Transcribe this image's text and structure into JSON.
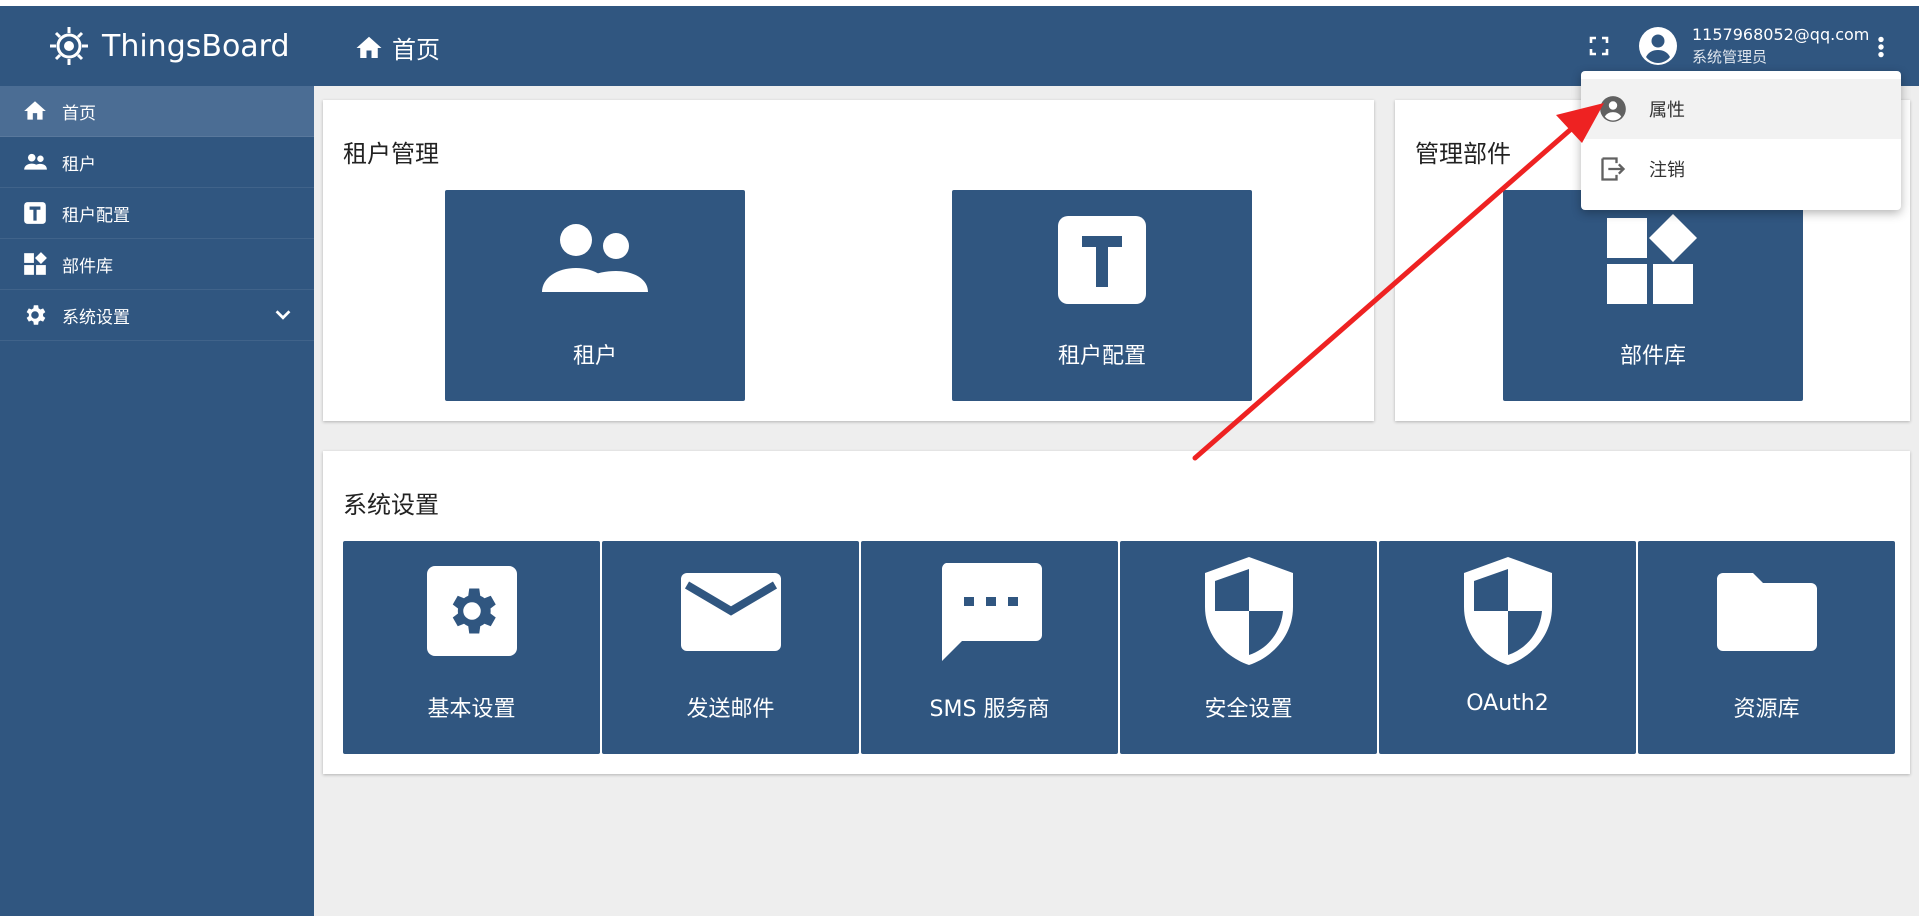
{
  "app": {
    "name": "ThingsBoard"
  },
  "sidebar": {
    "items": [
      {
        "label": "首页",
        "icon": "home-icon"
      },
      {
        "label": "租户",
        "icon": "people-icon"
      },
      {
        "label": "租户配置",
        "icon": "tenant-profile-icon"
      },
      {
        "label": "部件库",
        "icon": "widgets-icon"
      },
      {
        "label": "系统设置",
        "icon": "gear-icon"
      }
    ]
  },
  "header": {
    "breadcrumb": "首页",
    "user_email": "1157968052@qq.com",
    "user_role": "系统管理员"
  },
  "cards": {
    "tenant_mgmt": {
      "title": "租户管理",
      "tiles": [
        "租户",
        "租户配置"
      ]
    },
    "widget_mgmt": {
      "title": "管理部件",
      "tiles": [
        "部件库"
      ]
    },
    "system_settings": {
      "title": "系统设置",
      "tiles": [
        "基本设置",
        "发送邮件",
        "SMS 服务商",
        "安全设置",
        "OAuth2",
        "资源库"
      ]
    }
  },
  "user_menu": {
    "items": [
      {
        "label": "属性",
        "icon": "account-circle-icon"
      },
      {
        "label": "注销",
        "icon": "logout-icon"
      }
    ]
  },
  "colors": {
    "primary": "#305680",
    "active_nav": "#4b6d94",
    "annotation_arrow": "#ee2222"
  }
}
